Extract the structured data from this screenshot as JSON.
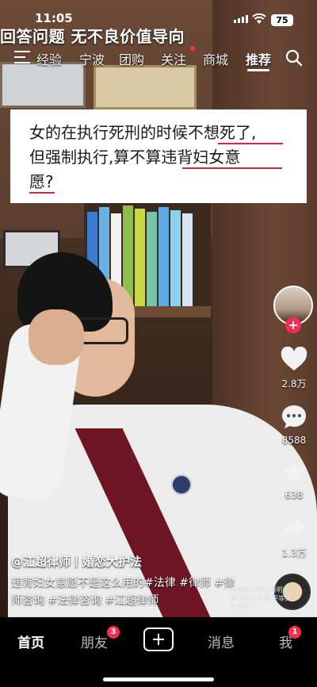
{
  "status_bar": {
    "time": "11:05",
    "battery": "75"
  },
  "banner": {
    "text": "回答问题  无不良价值导向"
  },
  "top_tabs": [
    {
      "label": "经验"
    },
    {
      "label": "宁波"
    },
    {
      "label": "团购"
    },
    {
      "label": "关注"
    },
    {
      "label": "商城"
    },
    {
      "label": "推荐"
    }
  ],
  "question_card": {
    "lines": [
      "女的在执行死刑的时候不想死了,",
      "但强制执行,算不算违背妇女意",
      "愿?"
    ]
  },
  "actions": {
    "like_count": "2.8万",
    "comment_count": "8588",
    "favorite_count": "638",
    "share_count": "1.3万"
  },
  "post": {
    "author": "@江超律师丨婚恋大护法",
    "caption": "违背妇女意愿不是这么用的#法律 #律师 #律师咨询 #法律咨询 #江超律师",
    "promo": "顶律育人律师 清明监律 守护人生路 平等实效交职"
  },
  "bottom_nav": {
    "home": "首页",
    "friends": "朋友",
    "friends_badge": "3",
    "messages": "消息",
    "me": "我",
    "me_badge": "1"
  },
  "colors": {
    "accent": "#fe2c55",
    "underline": "#d1283a"
  }
}
